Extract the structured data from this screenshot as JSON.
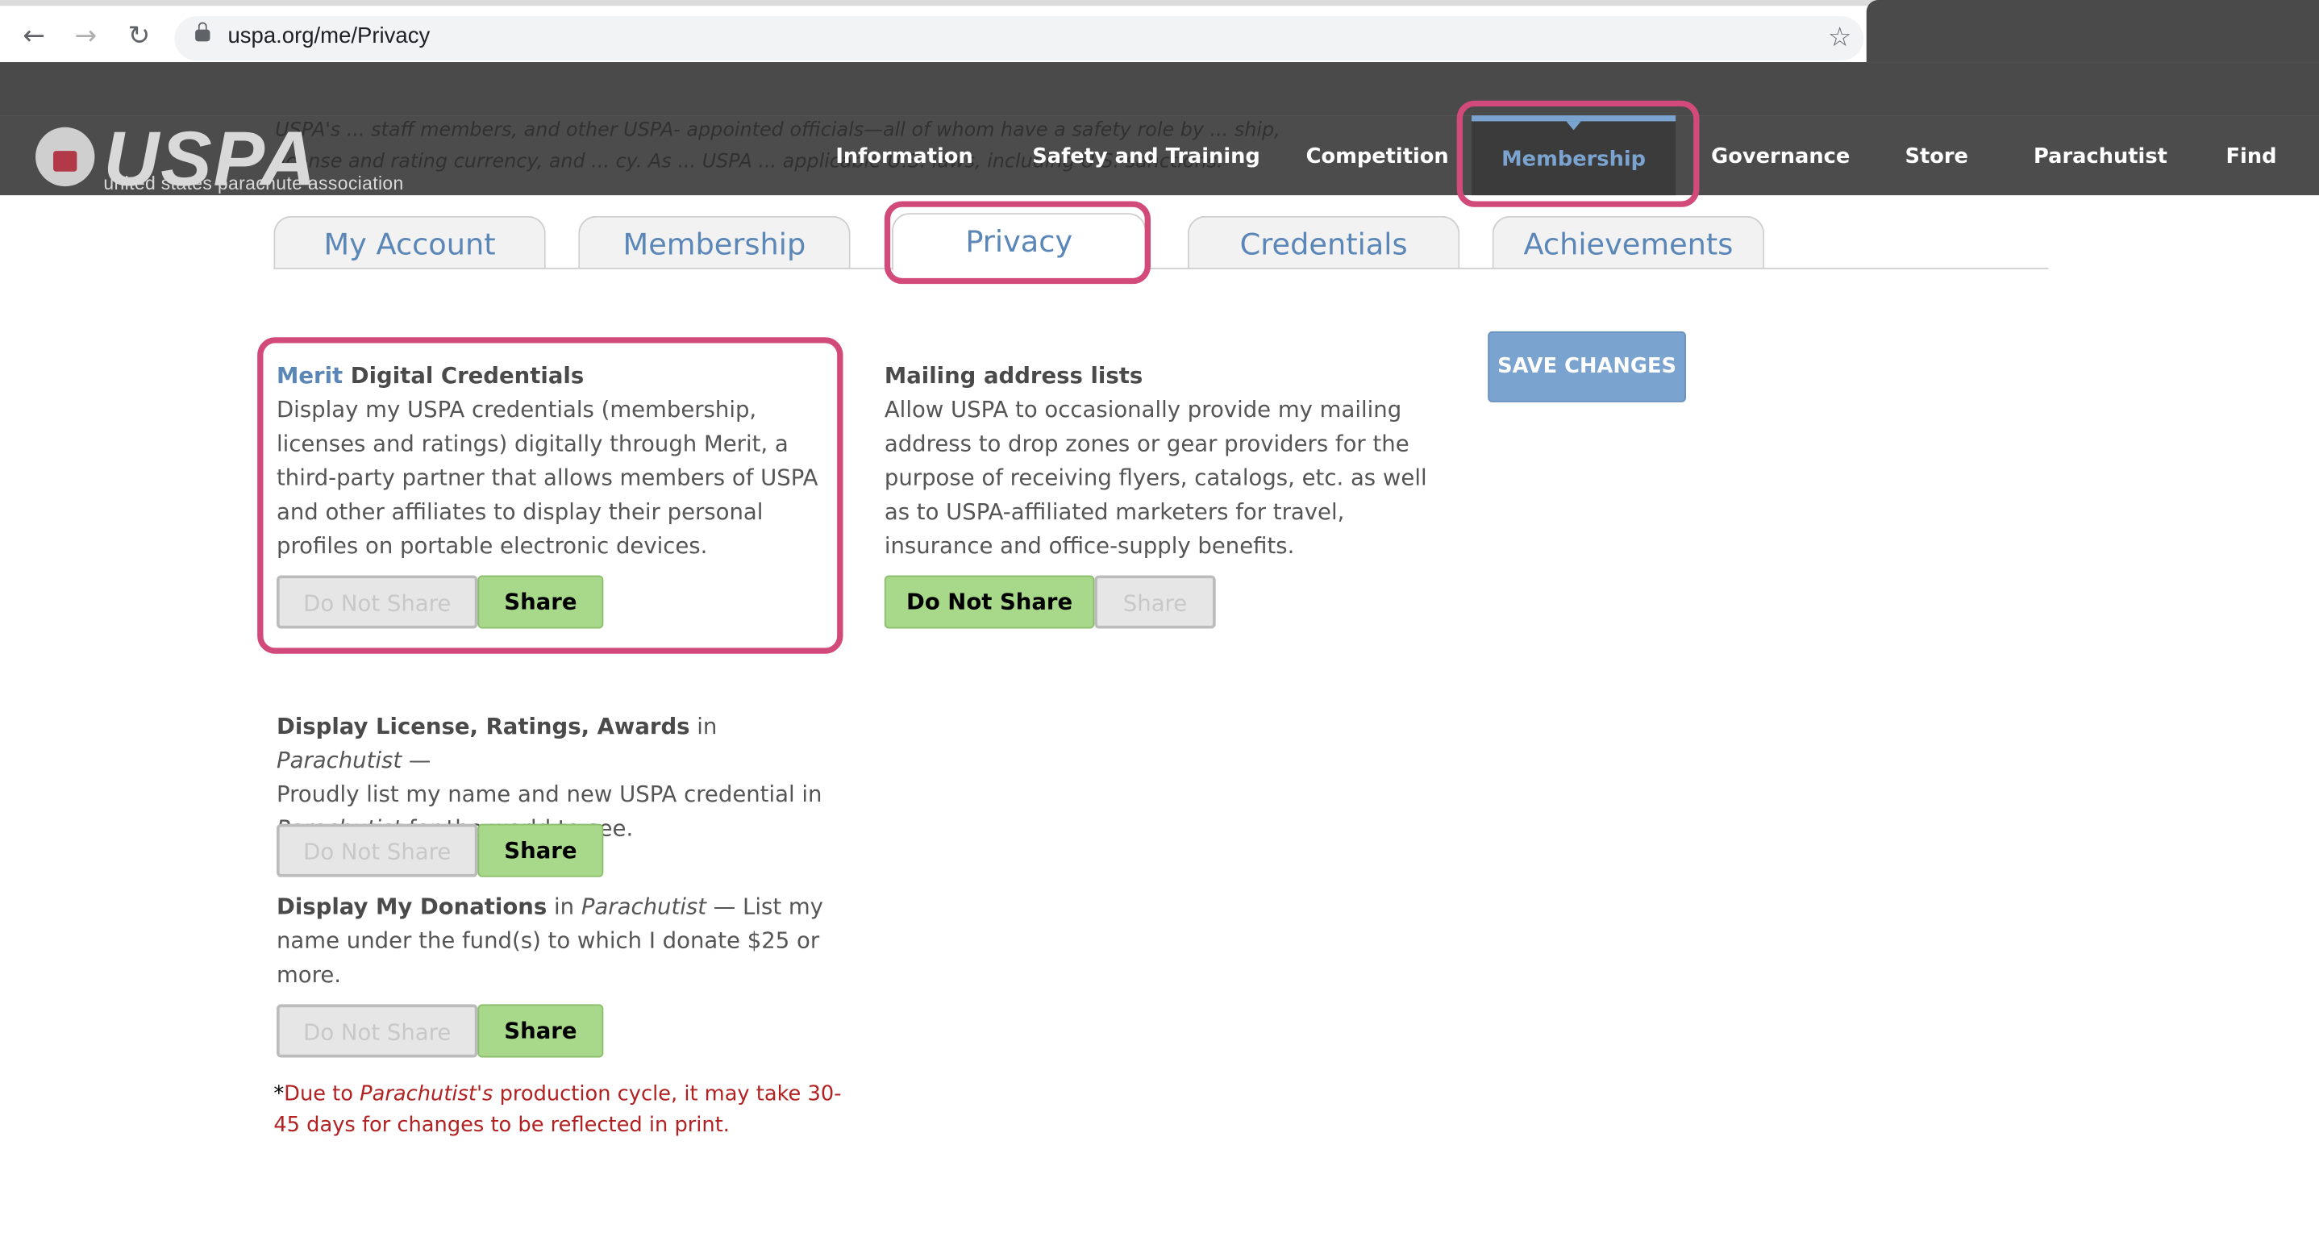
{
  "browser": {
    "url": "uspa.org/me/Privacy",
    "back_icon": "back-arrow-icon",
    "forward_icon": "forward-arrow-icon",
    "reload_icon": "reload-icon",
    "bookmark_icon": "star-icon"
  },
  "site": {
    "logo_text": "USPA",
    "logo_sub": "united states parachute association",
    "background_text": "USPA's ... staff members, and other USPA- appointed officials—all of whom have a safety role by ... ship, license and rating currency, and ... cy. As ... USPA ... applicable U.S. laws, including U.S. sanctions.",
    "nav": [
      "Information",
      "Safety and Training",
      "Competition",
      "Membership",
      "Governance",
      "Store",
      "Parachutist",
      "Find"
    ],
    "active_nav": "Membership"
  },
  "tabs": [
    "My Account",
    "Membership",
    "Privacy",
    "Credentials",
    "Achievements"
  ],
  "active_tab": "Privacy",
  "save_label": "SAVE CHANGES",
  "sections": {
    "merit": {
      "title_link": "Merit",
      "title_rest": " Digital Credentials",
      "body": "Display my USPA credentials (membership, licenses and ratings) digitally through Merit, a third-party partner that allows members of USPA and other affiliates to display their personal profiles on portable electronic devices.",
      "btn_off": "Do Not Share",
      "btn_on": "Share",
      "selected": "Share"
    },
    "mailing": {
      "title": "Mailing address lists",
      "body": "Allow USPA to occasionally provide my mailing address to drop zones or gear providers for the purpose of receiving flyers, catalogs, etc. as well as to USPA-affiliated marketers for travel, insurance and office-supply benefits.",
      "btn_on": "Do Not Share",
      "btn_off": "Share",
      "selected": "Do Not Share"
    },
    "license": {
      "title": "Display License, Ratings, Awards",
      "in": " in ",
      "pub": "Parachutist",
      "dash": " —",
      "body1": "Proudly list my name and new USPA credential in ",
      "pub2": "Parachutist",
      "body2": " for the world to see.",
      "btn_off": "Do Not Share",
      "btn_on": "Share",
      "selected": "Share"
    },
    "donations": {
      "title": "Display My Donations",
      "in": " in ",
      "pub": "Parachutist",
      "body": " — List my name under the fund(s) to which I donate $25 or more.",
      "btn_off": "Do Not Share",
      "btn_on": "Share",
      "selected": "Share"
    }
  },
  "note": {
    "star": "*",
    "pre": "Due to ",
    "pub": "Parachutist's",
    "post": " production cycle, it may take 30-45 days for changes to be reflected in print."
  },
  "colors": {
    "highlight": "#d14a7a",
    "accent": "#7aa3cf",
    "share_green": "#a8d88a",
    "note_red": "#b22222"
  }
}
